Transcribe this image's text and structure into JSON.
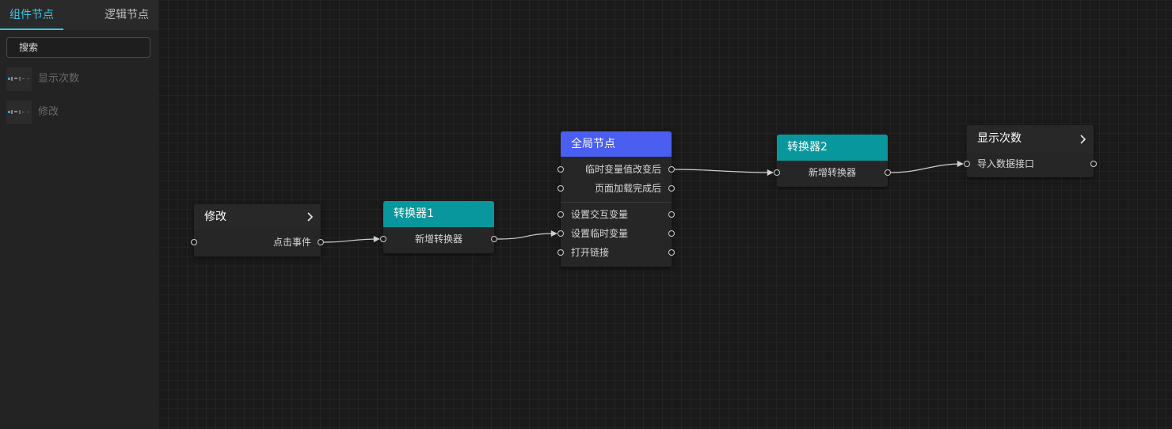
{
  "sidebar": {
    "tabs": [
      {
        "label": "组件节点",
        "active": true
      },
      {
        "label": "逻辑节点",
        "active": false
      }
    ],
    "search": {
      "placeholder": "搜索",
      "value": ""
    },
    "items": [
      {
        "label": "显示次数",
        "thumb_icon": "node-thumbnail-icon"
      },
      {
        "label": "修改",
        "thumb_icon": "node-thumbnail-icon"
      }
    ]
  },
  "canvas": {
    "nodes": {
      "modify": {
        "title": "修改",
        "outputs": [
          "点击事件"
        ]
      },
      "converter1": {
        "title": "转换器1",
        "ports": [
          "新增转换器"
        ]
      },
      "global": {
        "title": "全局节点",
        "events": [
          "临时变量值改变后",
          "页面加载完成后"
        ],
        "actions": [
          "设置交互变量",
          "设置临时变量",
          "打开链接"
        ]
      },
      "converter2": {
        "title": "转换器2",
        "ports": [
          "新增转换器"
        ]
      },
      "display": {
        "title": "显示次数",
        "inputs": [
          "导入数据接口"
        ]
      }
    }
  },
  "colors": {
    "accent": "#3ec6e0",
    "teal_header": "#08979c",
    "blue_header": "#4a5ef0",
    "node_body": "#262626",
    "canvas_bg": "#1a1a1a"
  }
}
